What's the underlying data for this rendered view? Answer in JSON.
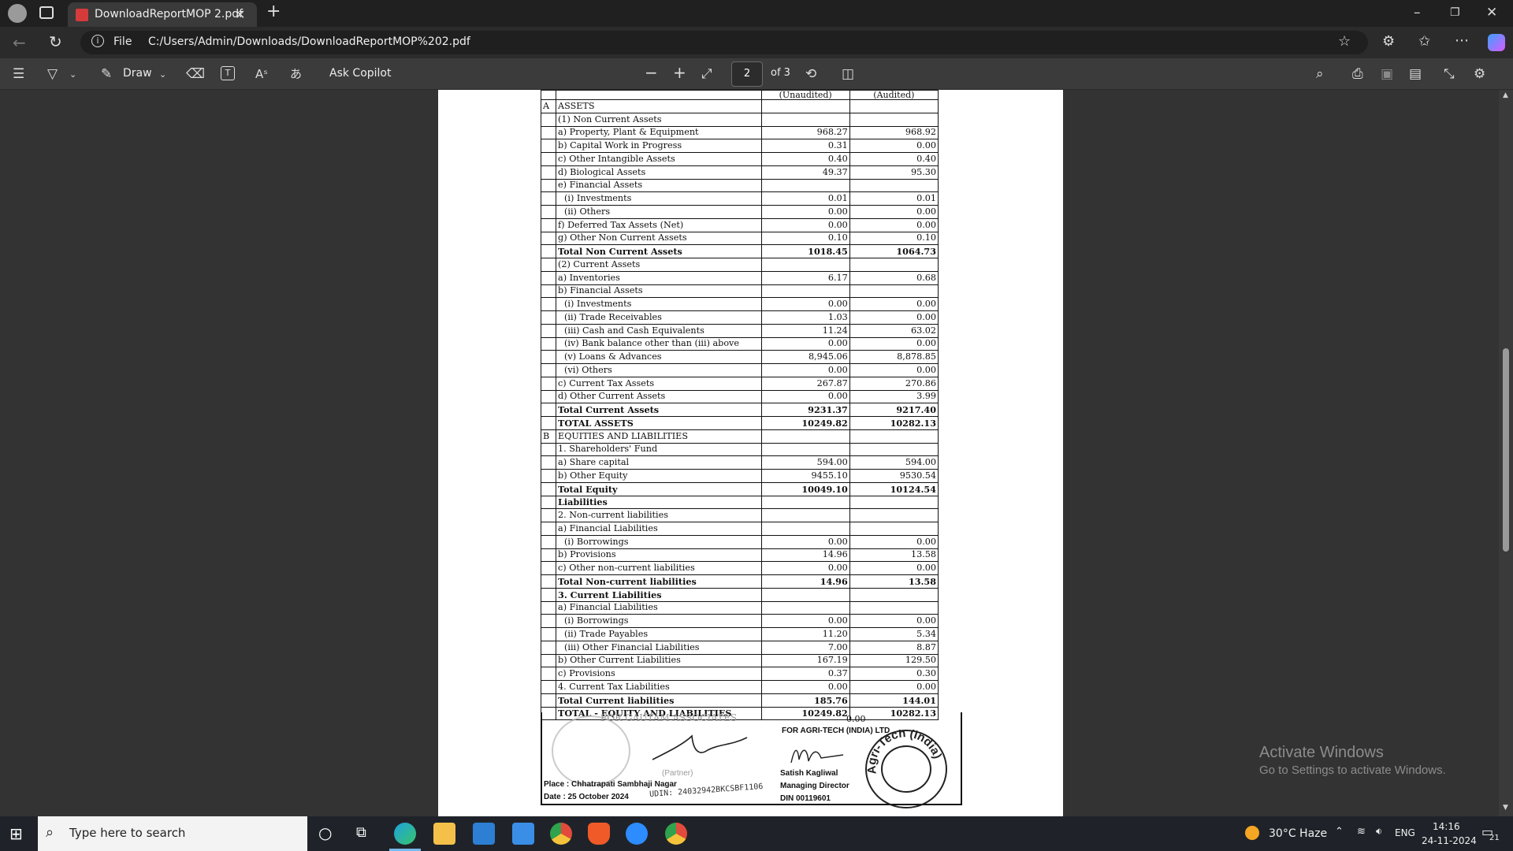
{
  "browser": {
    "tab_title": "DownloadReportMOP 2.pdf",
    "file_label": "File",
    "url": "C:/Users/Admin/Downloads/DownloadReportMOP%202.pdf"
  },
  "pdf_toolbar": {
    "draw_label": "Draw",
    "ask_copilot": "Ask Copilot",
    "page_current": "2",
    "page_total": "of 3"
  },
  "balance_sheet": {
    "col_unaudited": "(Unaudited)",
    "col_audited": "(Audited)",
    "rows": [
      {
        "sec": "A",
        "label": "ASSETS",
        "v1": "",
        "v2": "",
        "bold": false,
        "indent": 0
      },
      {
        "sec": "",
        "label": "(1) Non Current Assets",
        "v1": "",
        "v2": "",
        "bold": false,
        "indent": 0
      },
      {
        "sec": "",
        "label": "a) Property, Plant & Equipment",
        "v1": "968.27",
        "v2": "968.92",
        "bold": false,
        "indent": 0
      },
      {
        "sec": "",
        "label": "b) Capital Work in Progress",
        "v1": "0.31",
        "v2": "0.00",
        "bold": false,
        "indent": 0
      },
      {
        "sec": "",
        "label": "c) Other Intangible Assets",
        "v1": "0.40",
        "v2": "0.40",
        "bold": false,
        "indent": 0
      },
      {
        "sec": "",
        "label": "d) Biological Assets",
        "v1": "49.37",
        "v2": "95.30",
        "bold": false,
        "indent": 0
      },
      {
        "sec": "",
        "label": "e) Financial Assets",
        "v1": "",
        "v2": "",
        "bold": false,
        "indent": 0
      },
      {
        "sec": "",
        "label": "(i) Investments",
        "v1": "0.01",
        "v2": "0.01",
        "bold": false,
        "indent": 1
      },
      {
        "sec": "",
        "label": "(ii) Others",
        "v1": "0.00",
        "v2": "0.00",
        "bold": false,
        "indent": 1
      },
      {
        "sec": "",
        "label": "f) Deferred Tax Assets (Net)",
        "v1": "0.00",
        "v2": "0.00",
        "bold": false,
        "indent": 0
      },
      {
        "sec": "",
        "label": "g) Other Non Current Assets",
        "v1": "0.10",
        "v2": "0.10",
        "bold": false,
        "indent": 0
      },
      {
        "sec": "",
        "label": "Total Non Current Assets",
        "v1": "1018.45",
        "v2": "1064.73",
        "bold": true,
        "indent": 0
      },
      {
        "sec": "",
        "label": "(2) Current Assets",
        "v1": "",
        "v2": "",
        "bold": false,
        "indent": 0
      },
      {
        "sec": "",
        "label": "a) Inventories",
        "v1": "6.17",
        "v2": "0.68",
        "bold": false,
        "indent": 0
      },
      {
        "sec": "",
        "label": "b) Financial Assets",
        "v1": "",
        "v2": "",
        "bold": false,
        "indent": 0
      },
      {
        "sec": "",
        "label": "(i) Investments",
        "v1": "0.00",
        "v2": "0.00",
        "bold": false,
        "indent": 1
      },
      {
        "sec": "",
        "label": "(ii) Trade Receivables",
        "v1": "1.03",
        "v2": "0.00",
        "bold": false,
        "indent": 1
      },
      {
        "sec": "",
        "label": "(iii) Cash and Cash Equivalents",
        "v1": "11.24",
        "v2": "63.02",
        "bold": false,
        "indent": 1
      },
      {
        "sec": "",
        "label": "(iv) Bank balance other than (iii) above",
        "v1": "0.00",
        "v2": "0.00",
        "bold": false,
        "indent": 1
      },
      {
        "sec": "",
        "label": "(v) Loans & Advances",
        "v1": "8,945.06",
        "v2": "8,878.85",
        "bold": false,
        "indent": 1
      },
      {
        "sec": "",
        "label": "(vi) Others",
        "v1": "0.00",
        "v2": "0.00",
        "bold": false,
        "indent": 1
      },
      {
        "sec": "",
        "label": "c) Current Tax Assets",
        "v1": "267.87",
        "v2": "270.86",
        "bold": false,
        "indent": 0
      },
      {
        "sec": "",
        "label": "d) Other Current Assets",
        "v1": "0.00",
        "v2": "3.99",
        "bold": false,
        "indent": 0
      },
      {
        "sec": "",
        "label": "Total Current Assets",
        "v1": "9231.37",
        "v2": "9217.40",
        "bold": true,
        "indent": 0
      },
      {
        "sec": "",
        "label": "TOTAL ASSETS",
        "v1": "10249.82",
        "v2": "10282.13",
        "bold": true,
        "indent": 0
      },
      {
        "sec": "B",
        "label": "EQUITIES AND LIABILITIES",
        "v1": "",
        "v2": "",
        "bold": false,
        "indent": 0
      },
      {
        "sec": "",
        "label": "1. Shareholders' Fund",
        "v1": "",
        "v2": "",
        "bold": false,
        "indent": 0
      },
      {
        "sec": "",
        "label": "a) Share capital",
        "v1": "594.00",
        "v2": "594.00",
        "bold": false,
        "indent": 0
      },
      {
        "sec": "",
        "label": "b) Other Equity",
        "v1": "9455.10",
        "v2": "9530.54",
        "bold": false,
        "indent": 0
      },
      {
        "sec": "",
        "label": "Total Equity",
        "v1": "10049.10",
        "v2": "10124.54",
        "bold": true,
        "indent": 0
      },
      {
        "sec": "",
        "label": "Liabilities",
        "v1": "",
        "v2": "",
        "bold": true,
        "indent": 0
      },
      {
        "sec": "",
        "label": "2. Non-current liabilities",
        "v1": "",
        "v2": "",
        "bold": false,
        "indent": 0
      },
      {
        "sec": "",
        "label": "a) Financial Liabilities",
        "v1": "",
        "v2": "",
        "bold": false,
        "indent": 0
      },
      {
        "sec": "",
        "label": "(i) Borrowings",
        "v1": "0.00",
        "v2": "0.00",
        "bold": false,
        "indent": 1
      },
      {
        "sec": "",
        "label": "b) Provisions",
        "v1": "14.96",
        "v2": "13.58",
        "bold": false,
        "indent": 0
      },
      {
        "sec": "",
        "label": "c) Other non-current liabilities",
        "v1": "0.00",
        "v2": "0.00",
        "bold": false,
        "indent": 0
      },
      {
        "sec": "",
        "label": "Total Non-current liabilities",
        "v1": "14.96",
        "v2": "13.58",
        "bold": true,
        "indent": 0
      },
      {
        "sec": "",
        "label": "3. Current Liabilities",
        "v1": "",
        "v2": "",
        "bold": true,
        "indent": 0
      },
      {
        "sec": "",
        "label": "a) Financial Liabilities",
        "v1": "",
        "v2": "",
        "bold": false,
        "indent": 0
      },
      {
        "sec": "",
        "label": "(i) Borrowings",
        "v1": "0.00",
        "v2": "0.00",
        "bold": false,
        "indent": 1
      },
      {
        "sec": "",
        "label": "(ii) Trade Payables",
        "v1": "11.20",
        "v2": "5.34",
        "bold": false,
        "indent": 1
      },
      {
        "sec": "",
        "label": "(iii) Other Financial Liabilities",
        "v1": "7.00",
        "v2": "8.87",
        "bold": false,
        "indent": 1
      },
      {
        "sec": "",
        "label": "b) Other Current Liabilities",
        "v1": "167.19",
        "v2": "129.50",
        "bold": false,
        "indent": 0
      },
      {
        "sec": "",
        "label": "c) Provisions",
        "v1": "0.37",
        "v2": "0.30",
        "bold": false,
        "indent": 0
      },
      {
        "sec": "",
        "label": "4. Current Tax Liabilities",
        "v1": "0.00",
        "v2": "0.00",
        "bold": false,
        "indent": 0
      },
      {
        "sec": "",
        "label": "Total Current liabilities",
        "v1": "185.76",
        "v2": "144.01",
        "bold": true,
        "indent": 0
      },
      {
        "sec": "",
        "label": "TOTAL - EQUITY AND LIABILITIES",
        "v1": "10249.82",
        "v2": "10282.13",
        "bold": true,
        "indent": 0
      }
    ]
  },
  "signatures": {
    "stray_value": "0.00",
    "auditor_for": "FOR GAUTAM ASSOCIATES",
    "company_for": "FOR AGRI-TECH (INDIA) LTD",
    "signatory_name": "Satish Kagliwal",
    "signatory_title": "Managing Director",
    "signatory_din": "DIN 00119601",
    "place": "Place : Chhatrapati Sambhaji Nagar",
    "date": "Date  : 25 October 2024",
    "udin": "UDIN: 24032942BKCSBF1106",
    "partner": "(Partner)",
    "stamp_text": "Agri-Tech (India) Limited"
  },
  "watermark": {
    "title": "Activate Windows",
    "subtitle": "Go to Settings to activate Windows."
  },
  "taskbar": {
    "search_placeholder": "Type here to search",
    "weather": "30°C  Haze",
    "lang": "ENG",
    "time": "14:16",
    "date": "24-11-2024",
    "notif_count": "21"
  }
}
